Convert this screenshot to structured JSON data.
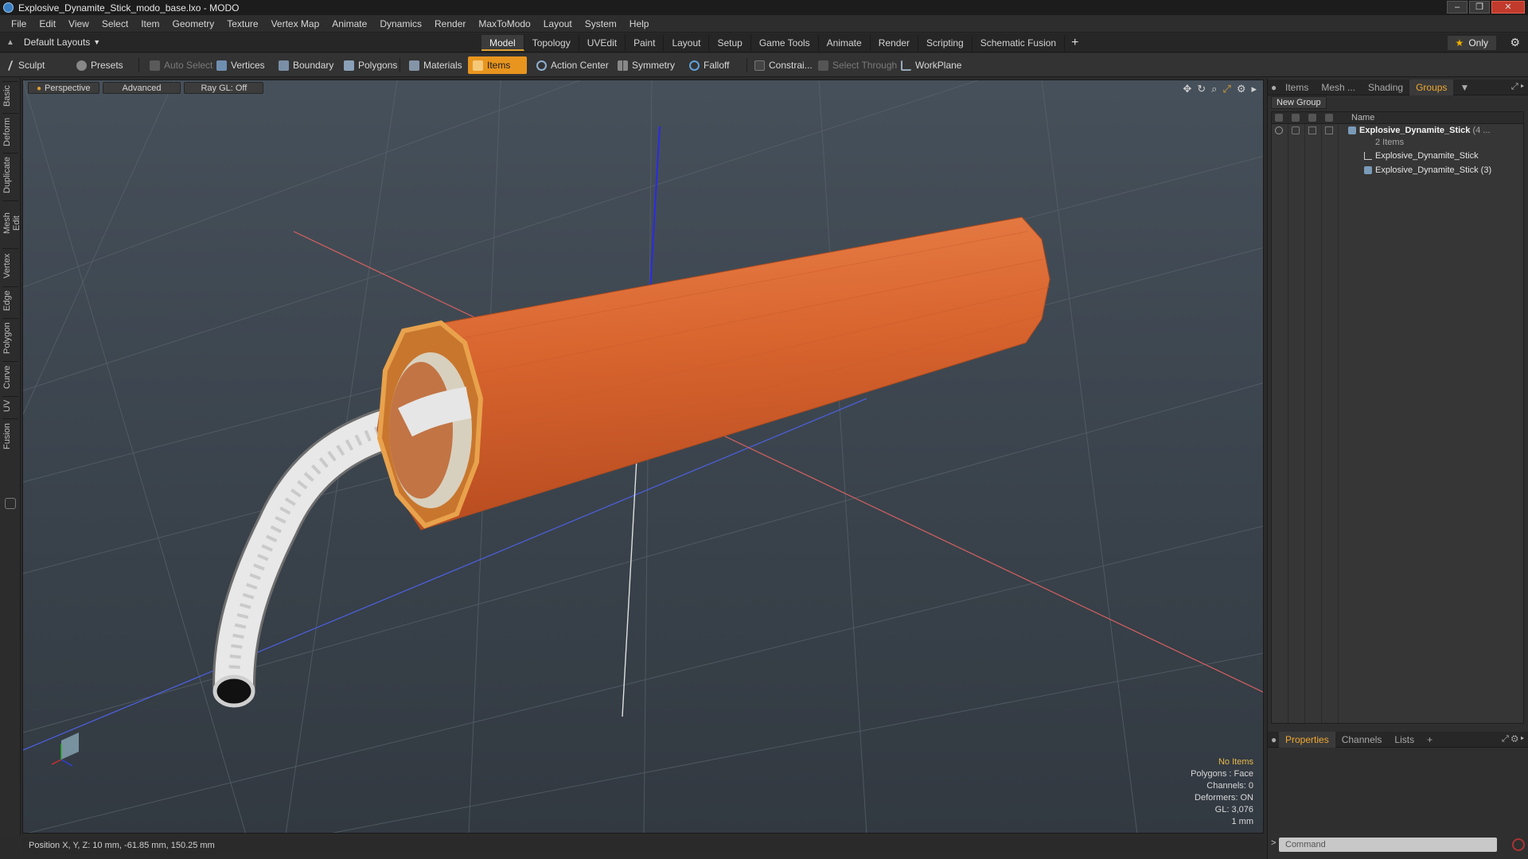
{
  "window": {
    "title": "Explosive_Dynamite_Stick_modo_base.lxo - MODO"
  },
  "menu": [
    "File",
    "Edit",
    "View",
    "Select",
    "Item",
    "Geometry",
    "Texture",
    "Vertex Map",
    "Animate",
    "Dynamics",
    "Render",
    "MaxToModo",
    "Layout",
    "System",
    "Help"
  ],
  "layouts_label": "Default Layouts",
  "tabs": [
    "Model",
    "Topology",
    "UVEdit",
    "Paint",
    "Layout",
    "Setup",
    "Game Tools",
    "Animate",
    "Render",
    "Scripting",
    "Schematic Fusion"
  ],
  "active_tab": "Model",
  "only_label": "Only",
  "toolbar": {
    "sculpt": "Sculpt",
    "presets": "Presets",
    "auto_select": "Auto Select",
    "vertices": "Vertices",
    "boundary": "Boundary",
    "polygons": "Polygons",
    "materials": "Materials",
    "items": "Items",
    "action_center": "Action Center",
    "symmetry": "Symmetry",
    "falloff": "Falloff",
    "constrain": "Constrai...",
    "select_through": "Select Through",
    "workplane": "WorkPlane"
  },
  "left_tabs": [
    "Basic",
    "Deform",
    "Duplicate",
    "Mesh Edit",
    "Vertex",
    "Edge",
    "Polygon",
    "Curve",
    "UV",
    "Fusion"
  ],
  "viewport": {
    "view": "Perspective",
    "shading": "Advanced",
    "raygl": "Ray GL: Off",
    "info": {
      "selection": "No Items",
      "polygons": "Polygons : Face",
      "channels": "Channels: 0",
      "deformers": "Deformers: ON",
      "gl": "GL: 3,076",
      "unit": "1 mm"
    }
  },
  "status": {
    "position": "Position X, Y, Z:  10 mm, -61.85 mm, 150.25 mm"
  },
  "right_panel": {
    "tabs": [
      "Items",
      "Mesh ...",
      "Shading",
      "Groups"
    ],
    "active_tab": "Groups",
    "new_group": "New Group",
    "column_name": "Name",
    "group": {
      "name": "Explosive_Dynamite_Stick",
      "count_suffix": "(4 ...",
      "sub": "2 Items",
      "children": [
        "Explosive_Dynamite_Stick",
        "Explosive_Dynamite_Stick (3)"
      ]
    },
    "bottom_tabs": [
      "Properties",
      "Channels",
      "Lists"
    ],
    "active_bottom_tab": "Properties",
    "command_placeholder": "Command"
  },
  "colors": {
    "accent": "#e8951f",
    "dynamite": "#d8652e",
    "fuse": "#e9e9e9",
    "axis_x": "#d04040",
    "axis_y": "#ffffff",
    "axis_z": "#2a2ae0"
  }
}
